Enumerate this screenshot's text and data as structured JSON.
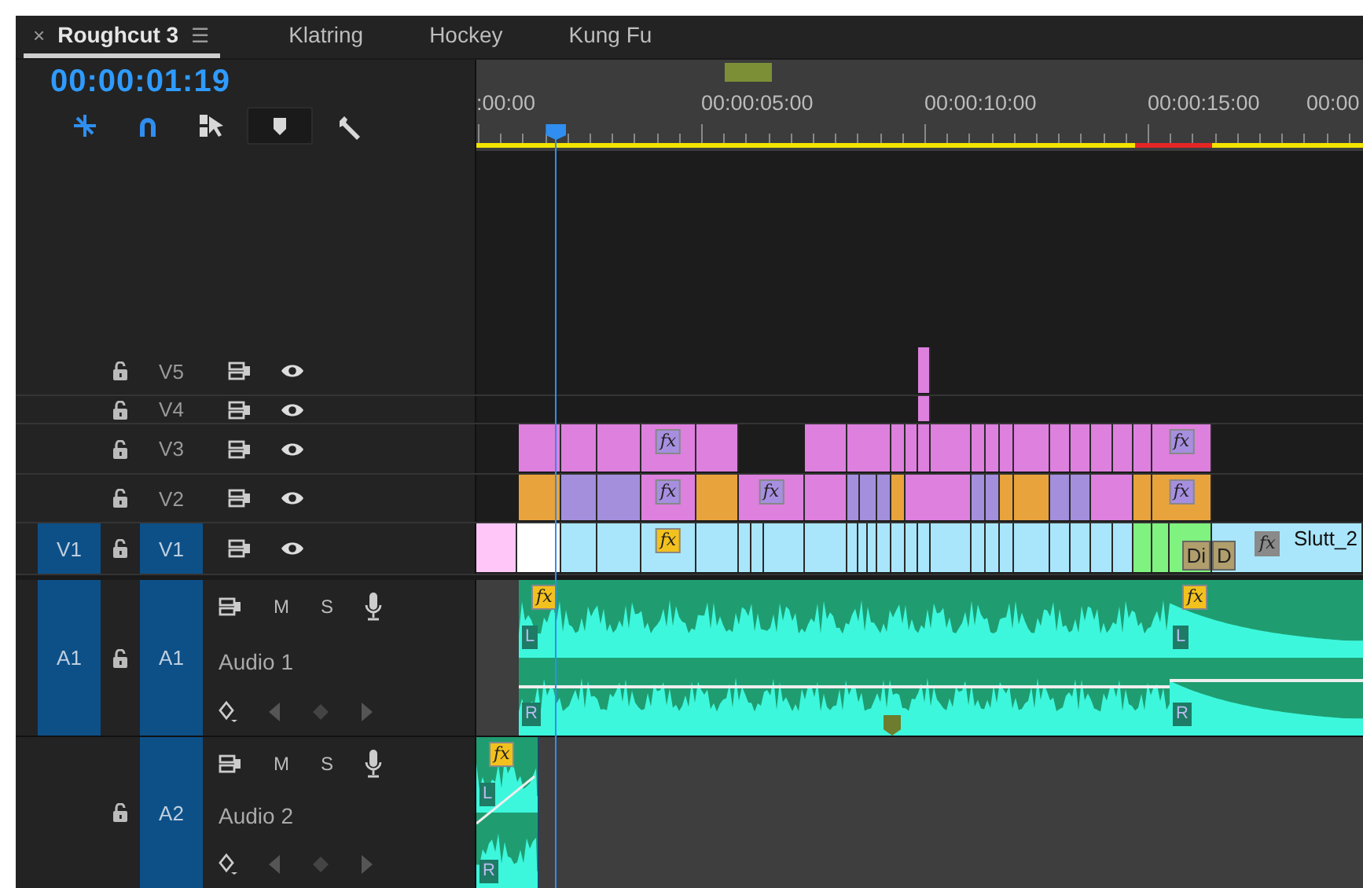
{
  "tabs": [
    {
      "label": "Roughcut 3",
      "selected": true,
      "close": "×",
      "menu": "☰"
    },
    {
      "label": "Klatring",
      "selected": false
    },
    {
      "label": "Hockey",
      "selected": false
    },
    {
      "label": "Kung Fu",
      "selected": false
    }
  ],
  "timecode": "00:00:01:19",
  "tools": [
    {
      "kind": "nest",
      "on": true
    },
    {
      "kind": "snap",
      "on": true
    },
    {
      "kind": "linked",
      "on": false
    },
    {
      "kind": "marker",
      "on": false
    },
    {
      "kind": "settings",
      "on": false
    }
  ],
  "ruler": {
    "labels": [
      ":00:00",
      "00:00:05:00",
      "00:00:10:00",
      "00:00:15:00",
      "00:00"
    ]
  },
  "playhead": {
    "level": 0.089
  },
  "video_tracks": [
    {
      "name": "V5",
      "targeted": false,
      "clips": [
        {
          "color": "#dd80de"
        }
      ]
    },
    {
      "name": "V4",
      "targeted": false,
      "clips": [
        {
          "color": "#dd80de"
        }
      ]
    },
    {
      "name": "V3",
      "targeted": false,
      "clips": [
        {
          "color": "#dd80de"
        },
        {
          "color": "#dd80de"
        },
        {
          "color": "#dd80de"
        },
        {
          "color": "#dd80de",
          "fx": {
            "label": "fx",
            "color": "#a78fe0"
          }
        },
        {
          "color": "#dd80de"
        },
        {
          "color": "#dd80de"
        },
        {
          "color": "#dd80de"
        },
        {
          "color": "#dd80de"
        },
        {
          "color": "#dd80de"
        },
        {
          "color": "#dd80de"
        },
        {
          "color": "#dd80de"
        },
        {
          "color": "#dd80de"
        },
        {
          "color": "#dd80de"
        },
        {
          "color": "#dd80de"
        },
        {
          "color": "#dd80de"
        },
        {
          "color": "#dd80de"
        },
        {
          "color": "#dd80de"
        },
        {
          "color": "#dd80de"
        },
        {
          "color": "#dd80de"
        },
        {
          "color": "#dd80de"
        },
        {
          "color": "#dd80de",
          "fx": {
            "label": "fx",
            "color": "#a78fe0"
          }
        }
      ]
    },
    {
      "name": "V2",
      "targeted": false,
      "clips": [
        {
          "color": "#e9a33c"
        },
        {
          "color": "#a38fdc"
        },
        {
          "color": "#a38fdc"
        },
        {
          "color": "#dd80de",
          "fx": {
            "label": "fx",
            "color": "#a78fe0"
          }
        },
        {
          "color": "#e9a33c"
        },
        {
          "color": "#dd80de",
          "fx": {
            "label": "fx",
            "color": "#a78fe0"
          }
        },
        {
          "color": "#dd80de"
        },
        {
          "color": "#a38fdc"
        },
        {
          "color": "#a38fdc"
        },
        {
          "color": "#a38fdc"
        },
        {
          "color": "#e9a33c"
        },
        {
          "color": "#dd80de"
        },
        {
          "color": "#a38fdc"
        },
        {
          "color": "#a38fdc"
        },
        {
          "color": "#e9a33c"
        },
        {
          "color": "#e9a33c"
        },
        {
          "color": "#a38fdc"
        },
        {
          "color": "#a38fdc"
        },
        {
          "color": "#dd80de"
        },
        {
          "color": "#e9a33c"
        },
        {
          "color": "#e9a33c",
          "fx": {
            "label": "fx",
            "color": "#a78fe0"
          }
        }
      ]
    },
    {
      "name": "V1",
      "source": "V1",
      "targeted": true,
      "clips": [
        {
          "color": "#ffc6f7"
        },
        {
          "color": "#ffffff"
        },
        {
          "color": "#a9e6fb"
        },
        {
          "color": "#a9e6fb"
        },
        {
          "color": "#a9e6fb",
          "fx": {
            "label": "fx",
            "color": "#f3c11d"
          }
        },
        {
          "color": "#a9e6fb"
        },
        {
          "color": "#a9e6fb"
        },
        {
          "color": "#a9e6fb"
        },
        {
          "color": "#a9e6fb"
        },
        {
          "color": "#a9e6fb"
        },
        {
          "color": "#a9e6fb"
        },
        {
          "color": "#a9e6fb"
        },
        {
          "color": "#a9e6fb"
        },
        {
          "color": "#a9e6fb"
        },
        {
          "color": "#a9e6fb"
        },
        {
          "color": "#a9e6fb"
        },
        {
          "color": "#a9e6fb"
        },
        {
          "color": "#a9e6fb"
        },
        {
          "color": "#a9e6fb"
        },
        {
          "color": "#a9e6fb"
        },
        {
          "color": "#a9e6fb"
        },
        {
          "color": "#a9e6fb"
        },
        {
          "color": "#a9e6fb"
        },
        {
          "color": "#a9e6fb"
        },
        {
          "color": "#a9e6fb"
        },
        {
          "color": "#a9e6fb"
        },
        {
          "color": "#7ff27f"
        },
        {
          "color": "#7ff27f"
        },
        {
          "color": "#7ff27f",
          "transition": "Di"
        },
        {
          "color": "#a9e6fb",
          "transition": "D",
          "fx": {
            "label": "fx",
            "color": "#8a8a8a"
          },
          "label": "Slutt_2"
        }
      ]
    }
  ],
  "audio_tracks": [
    {
      "source": "A1",
      "target": "A1",
      "targeted": true,
      "title": "Audio 1",
      "mute": "M",
      "solo": "S",
      "clips": [
        {
          "fx": {
            "label": "fx",
            "color": "#f3c11d"
          },
          "channels": [
            "L",
            "R"
          ]
        },
        {
          "fx": {
            "label": "fx",
            "color": "#f3c11d"
          },
          "channels": [
            "L",
            "R"
          ]
        }
      ]
    },
    {
      "target": "A2",
      "targeted": true,
      "title": "Audio 2",
      "mute": "M",
      "solo": "S",
      "clips": [
        {
          "fx": {
            "label": "fx",
            "color": "#f3c11d"
          },
          "channels": [
            "L",
            "R"
          ]
        }
      ]
    }
  ]
}
